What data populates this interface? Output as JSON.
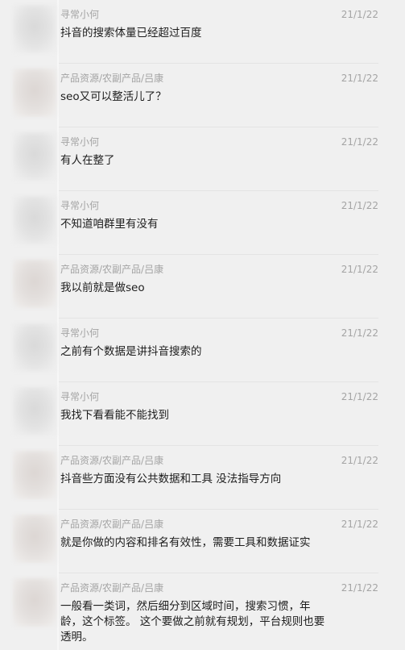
{
  "messages": [
    {
      "sender": "寻常小何",
      "time": "21/1/22",
      "text": "抖音的搜索体量已经超过百度"
    },
    {
      "sender": "产品资源/农副产品/吕康",
      "time": "21/1/22",
      "text": "seo又可以整活儿了？"
    },
    {
      "sender": "寻常小何",
      "time": "21/1/22",
      "text": "有人在整了"
    },
    {
      "sender": "寻常小何",
      "time": "21/1/22",
      "text": "不知道咱群里有没有"
    },
    {
      "sender": "产品资源/农副产品/吕康",
      "time": "21/1/22",
      "text": "我以前就是做seo"
    },
    {
      "sender": "寻常小何",
      "time": "21/1/22",
      "text": "之前有个数据是讲抖音搜索的"
    },
    {
      "sender": "寻常小何",
      "time": "21/1/22",
      "text": "我找下看看能不能找到"
    },
    {
      "sender": "产品资源/农副产品/吕康",
      "time": "21/1/22",
      "text": "抖音些方面没有公共数据和工具  没法指导方向"
    },
    {
      "sender": "产品资源/农副产品/吕康",
      "time": "21/1/22",
      "text": "就是你做的内容和排名有效性，需要工具和数据证实"
    },
    {
      "sender": "产品资源/农副产品/吕康",
      "time": "21/1/22",
      "text": "一般看一类词，然后细分到区域时间，搜索习惯，年龄，这个标签。  这个要做之前就有规划，平台规则也要透明。"
    }
  ]
}
